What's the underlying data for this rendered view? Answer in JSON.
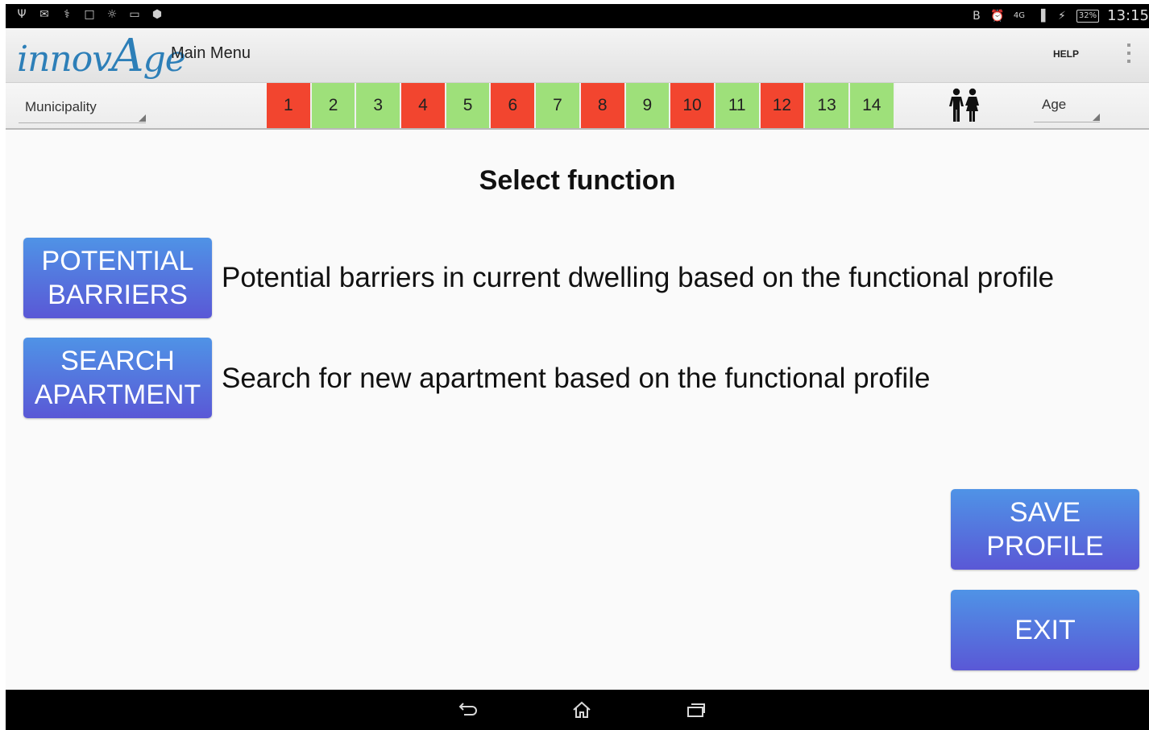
{
  "status_bar": {
    "left_icons": [
      "usb-icon",
      "gmail-icon",
      "usb-debug-icon",
      "screenshot-icon",
      "lightbulb-icon",
      "gallery-icon",
      "android-icon"
    ],
    "right_icons": [
      "bluetooth-icon",
      "alarm-icon",
      "network-icon",
      "signal-icon",
      "charging-icon"
    ],
    "network": "4G",
    "battery": "32%",
    "time": "13:15"
  },
  "action_bar": {
    "logo_prefix": "innov",
    "logo_cap": "A",
    "logo_suffix": "ge",
    "title": "Main Menu",
    "help_label": "HELP",
    "overflow_icon": "overflow-menu-icon"
  },
  "filters": {
    "municipality_label": "Municipality",
    "age_label": "Age",
    "persons_icon": "male-female-icon"
  },
  "profile_items": [
    {
      "label": "1",
      "color": "#f2452f"
    },
    {
      "label": "2",
      "color": "#9ee07a"
    },
    {
      "label": "3",
      "color": "#9ee07a"
    },
    {
      "label": "4",
      "color": "#f2452f"
    },
    {
      "label": "5",
      "color": "#9ee07a"
    },
    {
      "label": "6",
      "color": "#f2452f"
    },
    {
      "label": "7",
      "color": "#9ee07a"
    },
    {
      "label": "8",
      "color": "#f2452f"
    },
    {
      "label": "9",
      "color": "#9ee07a"
    },
    {
      "label": "10",
      "color": "#f2452f"
    },
    {
      "label": "11",
      "color": "#9ee07a"
    },
    {
      "label": "12",
      "color": "#f2452f"
    },
    {
      "label": "13",
      "color": "#9ee07a"
    },
    {
      "label": "14",
      "color": "#9ee07a"
    }
  ],
  "main": {
    "title": "Select function",
    "barriers_button": "POTENTIAL\nBARRIERS",
    "barriers_desc": "Potential barriers in current dwelling based on the functional profile",
    "search_button": "SEARCH\nAPARTMENT",
    "search_desc": "Search for new apartment based on the functional profile",
    "save_button": "SAVE\nPROFILE",
    "exit_button": "EXIT"
  },
  "nav_bar": {
    "icons": [
      "back-icon",
      "home-icon",
      "recent-apps-icon"
    ]
  },
  "colors": {
    "button_top": "#4f93e6",
    "button_bottom": "#5a58d6",
    "red": "#f2452f",
    "green": "#9ee07a",
    "logo": "#2d7fb8"
  }
}
